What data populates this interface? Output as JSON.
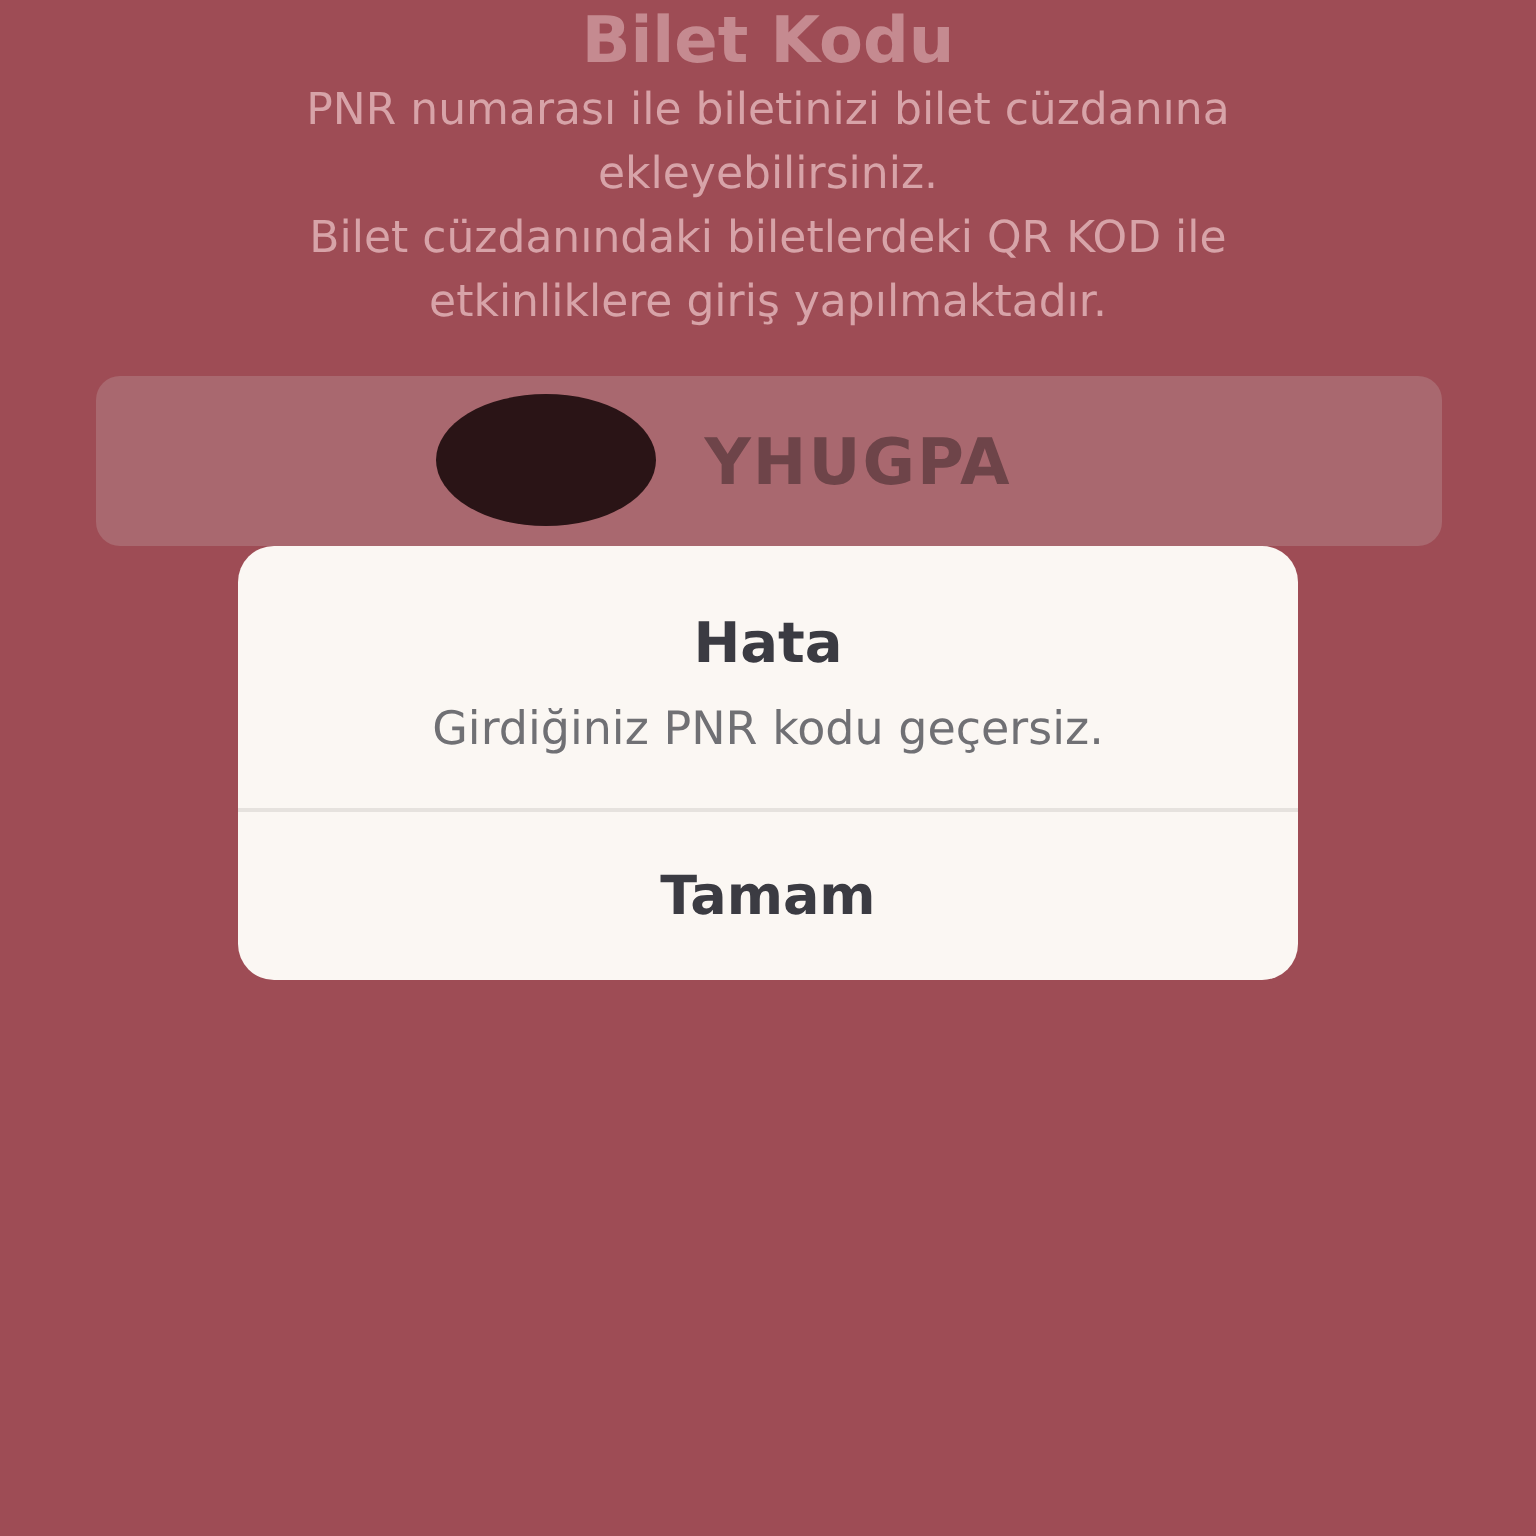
{
  "screen": {
    "title": "Bilet Kodu",
    "paragraphs": [
      "PNR numarası ile biletinizi bilet cüzdanına ekleyebilirsiniz.",
      "Bilet cüzdanındaki biletlerdeki QR KOD ile etkinliklere giriş yapılmaktadır."
    ],
    "pnr_field": {
      "value": "YHUGPA"
    }
  },
  "alert": {
    "title": "Hata",
    "message": "Girdiğiniz PNR kodu geçersiz.",
    "buttons": [
      "Tamam"
    ]
  }
}
